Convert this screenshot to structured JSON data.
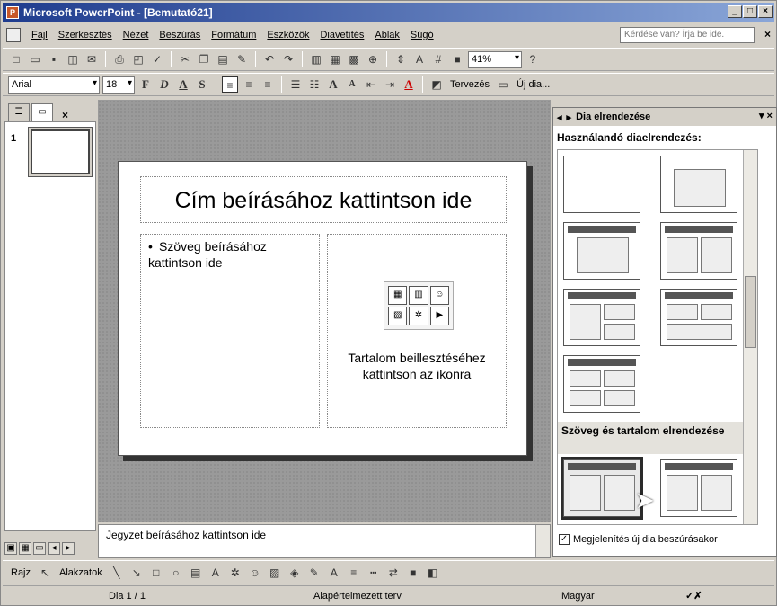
{
  "window": {
    "title": "Microsoft PowerPoint - [Bemutató21]",
    "min": "_",
    "max": "□",
    "close": "×"
  },
  "menu": [
    "Fájl",
    "Szerkesztés",
    "Nézet",
    "Beszúrás",
    "Formátum",
    "Eszközök",
    "Diavetítés",
    "Ablak",
    "Súgó"
  ],
  "help": {
    "placeholder": "Kérdése van? Írja be ide."
  },
  "toolbar": {
    "zoom": "41%"
  },
  "format": {
    "font": "Arial",
    "size": "18",
    "design": "Tervezés",
    "new_slide": "Új dia..."
  },
  "left_panel": {
    "slide_number": "1"
  },
  "slide": {
    "title": "Cím beírásához kattintson ide",
    "left_text": "Szöveg beírásához kattintson ide",
    "right_text": "Tartalom beillesztéséhez kattintson az ikonra"
  },
  "notes": {
    "placeholder": "Jegyzet beírásához kattintson ide"
  },
  "task_pane": {
    "title": "Dia elrendezése",
    "subtitle": "Használandó diaelrendezés:",
    "group_label": "Szöveg és tartalom elrendezése",
    "checkbox_label": "Megjelenítés új dia beszúrásakor"
  },
  "drawing": {
    "draw_label": "Rajz",
    "shapes_label": "Alakzatok"
  },
  "status": {
    "slide": "Dia 1 / 1",
    "design": "Alapértelmezett terv",
    "language": "Magyar"
  }
}
